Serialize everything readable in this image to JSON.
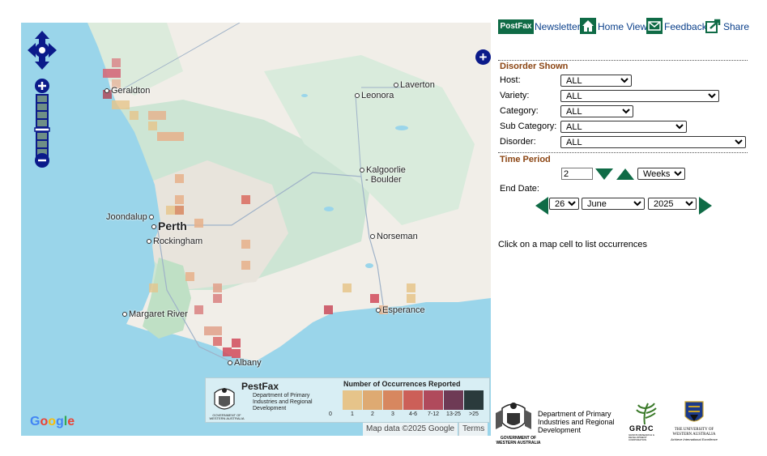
{
  "toolbar": {
    "brand": "PostFax",
    "newsletter": "Newsletter",
    "home_view": "Home View",
    "feedback": "Feedback",
    "share": "Share"
  },
  "disorder_section": {
    "title": "Disorder Shown",
    "host_label": "Host:",
    "host_value": "ALL",
    "variety_label": "Variety:",
    "variety_value": "ALL",
    "category_label": "Category:",
    "category_value": "ALL",
    "subcategory_label": "Sub Category:",
    "subcategory_value": "ALL",
    "disorder_label": "Disorder:",
    "disorder_value": "ALL"
  },
  "time_section": {
    "title": "Time Period",
    "period_value": "2",
    "period_unit": "Weeks",
    "end_date_label": "End Date:",
    "day": "26",
    "month": "June",
    "year": "2025"
  },
  "hint": "Click on a map cell to list occurrences",
  "map": {
    "cities": {
      "geraldton": "Geraldton",
      "leonora": "Leonora",
      "laverton": "Laverton",
      "kalgoorlie": "Kalgoorlie",
      "boulder": "- Boulder",
      "joondalup": "Joondalup",
      "perth": "Perth",
      "rockingham": "Rockingham",
      "norseman": "Norseman",
      "margaret_river": "Margaret River",
      "esperance": "Esperance",
      "albany": "Albany"
    },
    "google_logo": "Google",
    "attribution": "Map data ©2025 Google",
    "terms": "Terms",
    "fullscreen_icon": "+"
  },
  "legend": {
    "brand": "PestFax",
    "department": "Department of Primary Industries and Regional Development",
    "government_caption": "GOVERNMENT OF WESTERN AUSTRALIA",
    "title": "Number of Occurrences Reported",
    "zero": "0",
    "bins": [
      {
        "label": "1",
        "color": "#e6c48a"
      },
      {
        "label": "2",
        "color": "#deaa72"
      },
      {
        "label": "3",
        "color": "#d7875f"
      },
      {
        "label": "4-6",
        "color": "#cc5f58"
      },
      {
        "label": "7-12",
        "color": "#b04a5c"
      },
      {
        "label": "13-25",
        "color": "#6e3a55"
      },
      {
        "label": ">25",
        "color": "#2a3a3c"
      }
    ]
  },
  "footer": {
    "dpird_name": "Department of Primary Industries and Regional Development",
    "dpird_government": "GOVERNMENT OF WESTERN AUSTRALIA",
    "grdc": "GRDC",
    "grdc_sub": "GRAINS RESEARCH & DEVELOPMENT CORPORATION",
    "uwa_name": "THE UNIVERSITY OF WESTERN AUSTRALIA",
    "uwa_motto": "Achieve International Excellence"
  },
  "colors": {
    "accent_green": "#0f6b46",
    "section_brown": "#8b4513",
    "map_control_blue": "#0b1a8a",
    "ocean": "#9ad5ea"
  }
}
